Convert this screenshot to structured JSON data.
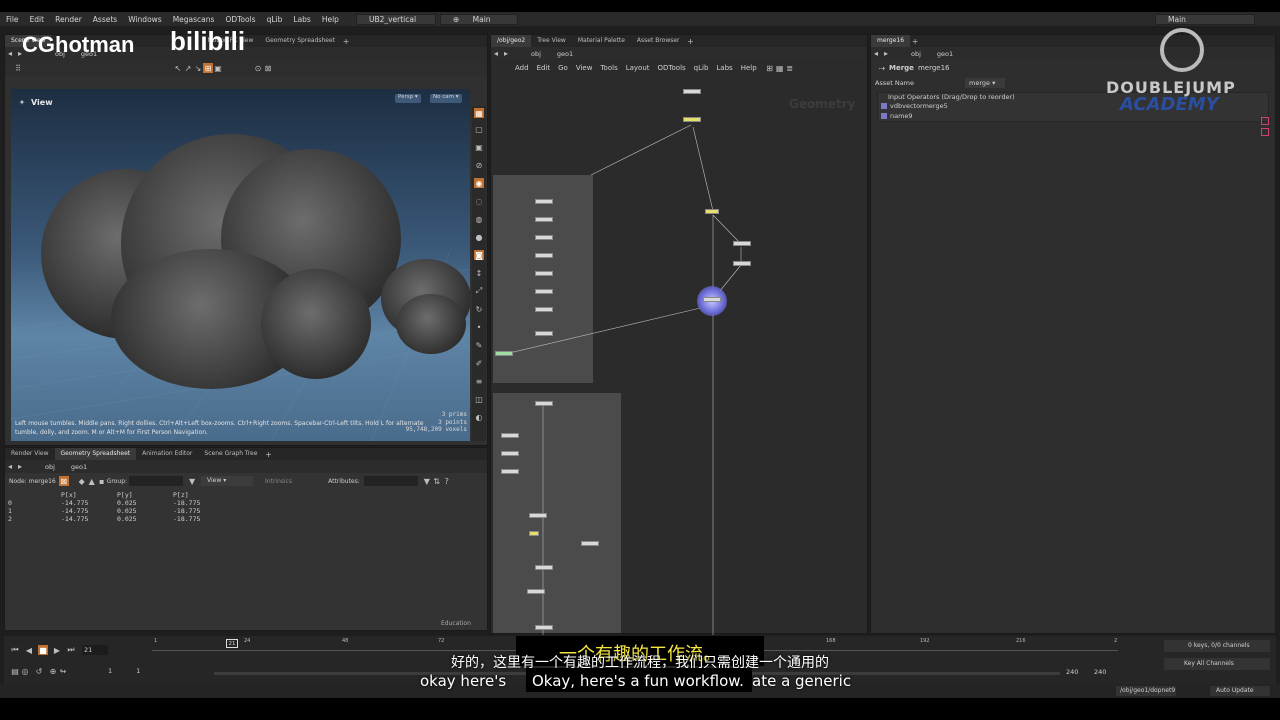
{
  "watermark": {
    "left": "CGhotman",
    "bili": "bilibili",
    "brand": "DOUBLEJUMP",
    "brand_sub": "ACADEMY"
  },
  "menu": [
    "File",
    "Edit",
    "Render",
    "Assets",
    "Windows",
    "Megascans",
    "ODTools",
    "qLib",
    "Labs",
    "Help"
  ],
  "desktop": "UB2_vertical",
  "desktop2": "Main",
  "desktop_right": "Main",
  "left_tabs": [
    "Scene View",
    "Motion FX View",
    "Geometry Spreadsheet"
  ],
  "left_path": {
    "obj": "obj",
    "geo": "geo1"
  },
  "viewport": {
    "title": "View",
    "persp": "Persp",
    "cam": "No cam",
    "help": "Left mouse tumbles. Middle pans. Right dollies. Ctrl+Alt+Left box-zooms. Ctrl+Right zooms. Spacebar-Ctrl-Left tilts. Hold L for alternate tumble, dolly, and zoom. M or Alt+M for First Person Navigation.",
    "stats": [
      "3  prims",
      "3  points",
      "95,748,209  voxels"
    ]
  },
  "bottom_tabs": [
    "Render View",
    "Geometry Spreadsheet",
    "Animation Editor",
    "Scene Graph Tree"
  ],
  "spreadsheet": {
    "node_label": "Node:",
    "node": "merge16",
    "group_label": "Group:",
    "view": "View",
    "intrinsics": "Intrinsics",
    "attributes": "Attributes:",
    "columns": [
      "",
      "P[x]",
      "P[y]",
      "P[z]"
    ],
    "rows": [
      [
        "0",
        "-14.775",
        "0.025",
        "-18.775"
      ],
      [
        "1",
        "-14.775",
        "0.025",
        "-18.775"
      ],
      [
        "2",
        "-14.775",
        "0.025",
        "-18.775"
      ]
    ],
    "education": "Education"
  },
  "net_tabs": [
    "/obj/geo2",
    "Tree View",
    "Material Palette",
    "Asset Browser"
  ],
  "net_path": {
    "obj": "obj",
    "geo": "geo1"
  },
  "net_menu": [
    "Add",
    "Edit",
    "Go",
    "View",
    "Tools",
    "Layout",
    "ODTools",
    "qLib",
    "Labs",
    "Help"
  ],
  "net_watermark": "Geometry",
  "params": {
    "tab": "merge16",
    "path_obj": "obj",
    "path_geo": "geo1",
    "type": "Merge",
    "name": "merge16",
    "asset_name_label": "Asset Name",
    "asset_name": "merge",
    "inputs_header": "Input Operators (Drag/Drop to reorder)",
    "inputs": [
      "vdbvectormerge5",
      "name9"
    ]
  },
  "timeline": {
    "frame": "21",
    "start": "1",
    "start2": "1",
    "end": "240",
    "end2": "240",
    "ticks": [
      "1",
      "24",
      "48",
      "72",
      "120",
      "168",
      "192",
      "216",
      "2"
    ],
    "current": "21",
    "keys": "0 keys, 0/0 channels",
    "key_all": "Key All Channels",
    "path": "/obj/geo1/dopnet9",
    "auto": "Auto Update"
  },
  "subtitles": {
    "top": "一个有趣的工作流。",
    "cn": "好的，这里有一个有趣的工作流程，我们只需创建一个通用的",
    "en_left": "okay here's",
    "en_main": "Okay, here's a fun workflow.",
    "en_right": "ate a generic"
  },
  "colors": {
    "accent": "#f0a030",
    "subtitle_yellow": "#f5e642",
    "node_selected": "#6a6ad8"
  }
}
